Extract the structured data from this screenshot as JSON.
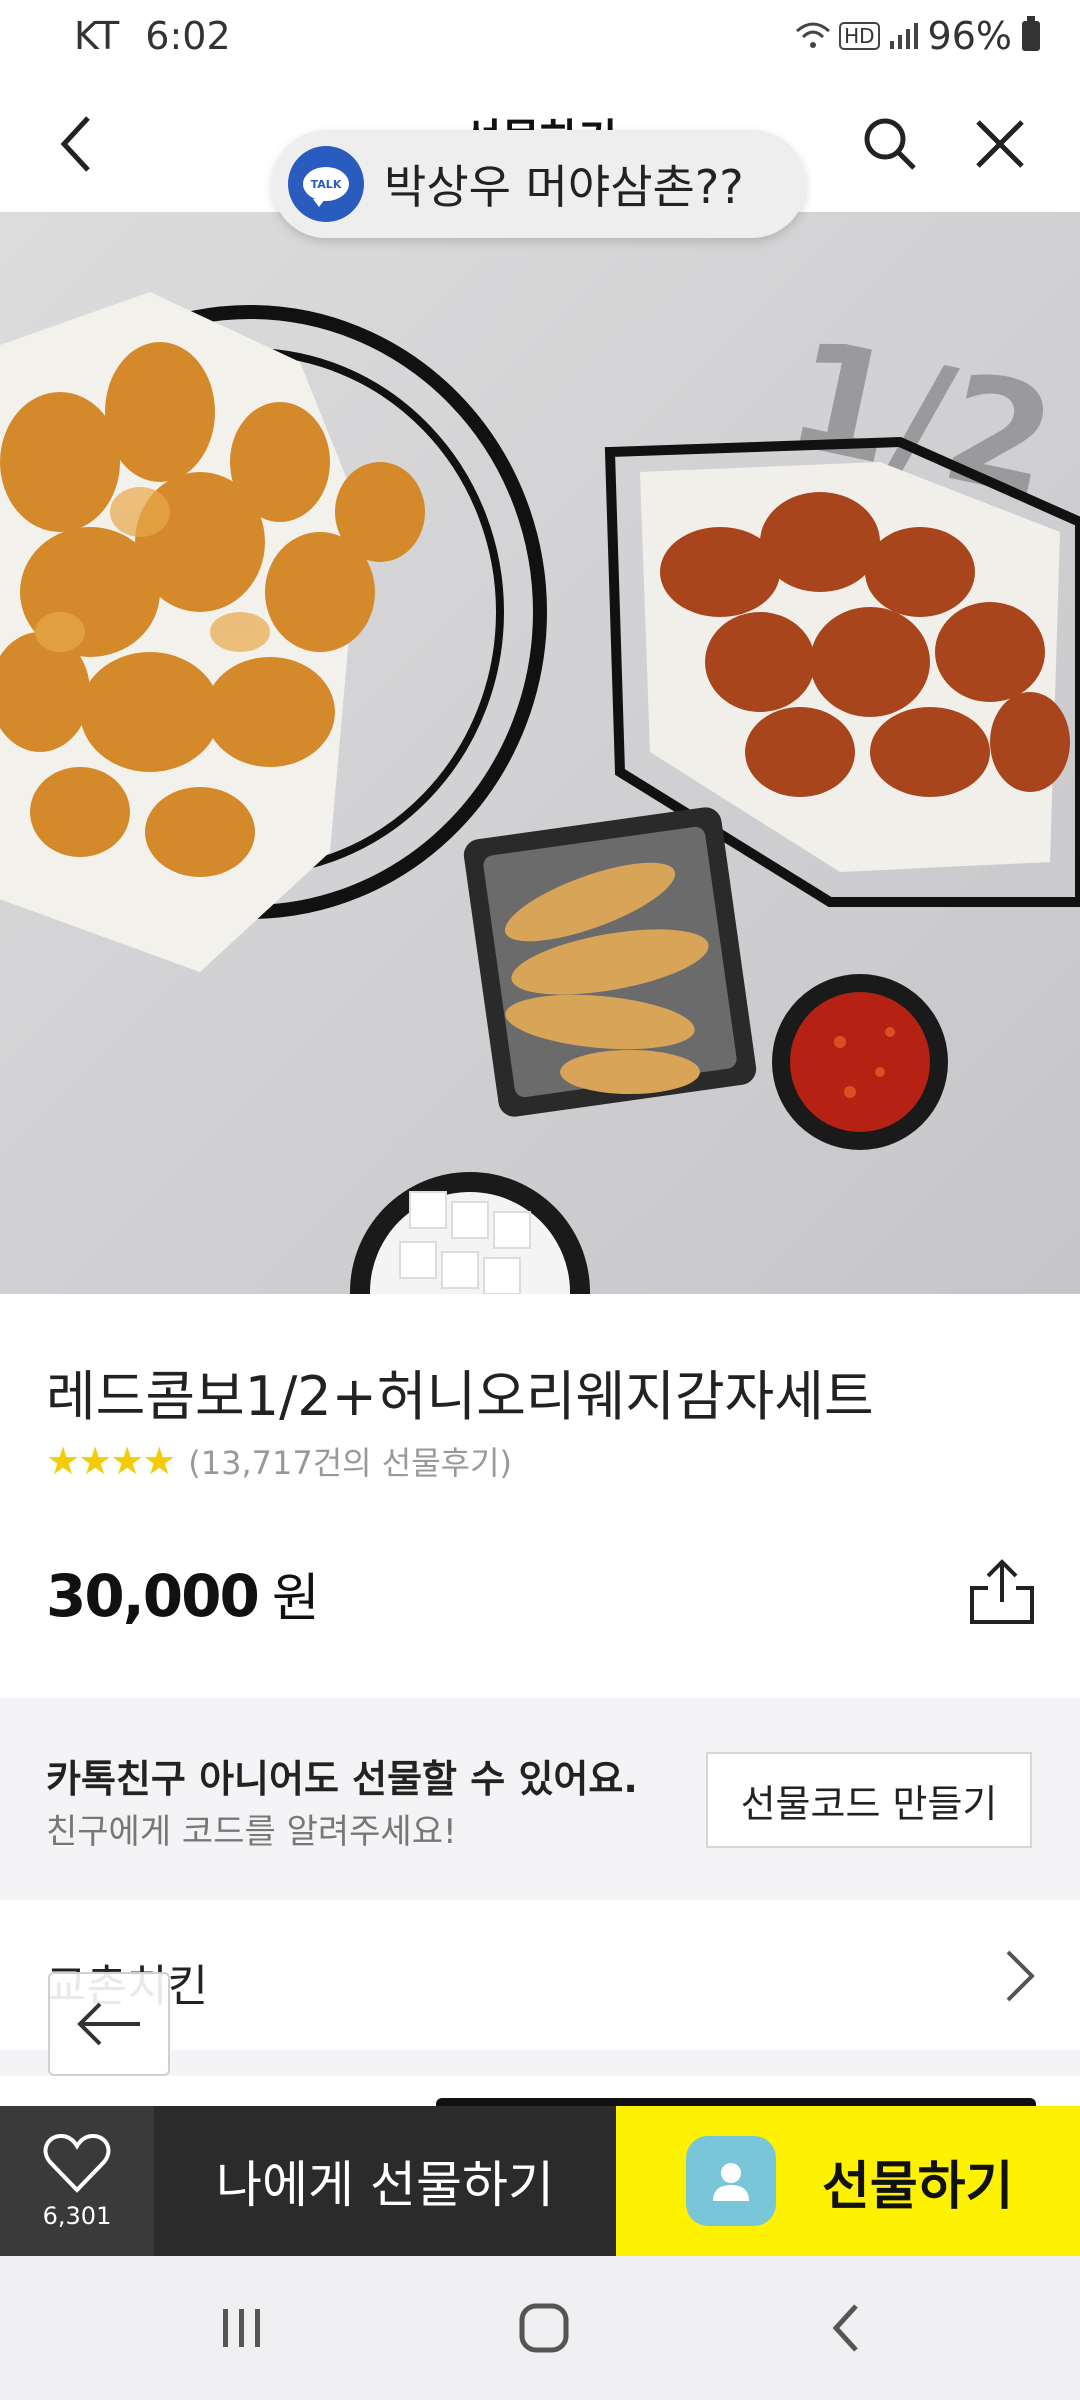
{
  "status_bar": {
    "carrier": "KT",
    "time": "6:02",
    "hd": "HD",
    "battery": "96%"
  },
  "header": {
    "title": "선물하기"
  },
  "talk_toast": {
    "icon_label": "TALK",
    "message": "박상우  머야삼촌??"
  },
  "product_image": {
    "watermark": "1/2"
  },
  "product": {
    "name": "레드콤보1/2+허니오리웨지감자세트",
    "stars": "★★★★",
    "review_count": "(13,717건의 선물후기)",
    "price": "30,000",
    "price_unit": "원"
  },
  "gift_code": {
    "title": "카톡친구 아니어도 선물할 수 있어요.",
    "subtitle": "친구에게 코드를 알려주세요!",
    "button": "선물코드 만들기"
  },
  "brand": {
    "name": "교촌치킨"
  },
  "action_bar": {
    "wish_count": "6,301",
    "self_gift": "나에게 선물하기",
    "gift": "선물하기"
  },
  "colors": {
    "accent_yellow": "#fef200",
    "dark": "#2b2b2b",
    "star": "#f5cc0a",
    "talk_blue": "#2a5bbf"
  },
  "icons": {
    "back": "chevron-left-icon",
    "search": "search-icon",
    "close": "close-icon",
    "share": "share-icon",
    "heart": "heart-icon",
    "chevron": "chevron-right-icon",
    "arrow_back": "arrow-left-icon"
  }
}
